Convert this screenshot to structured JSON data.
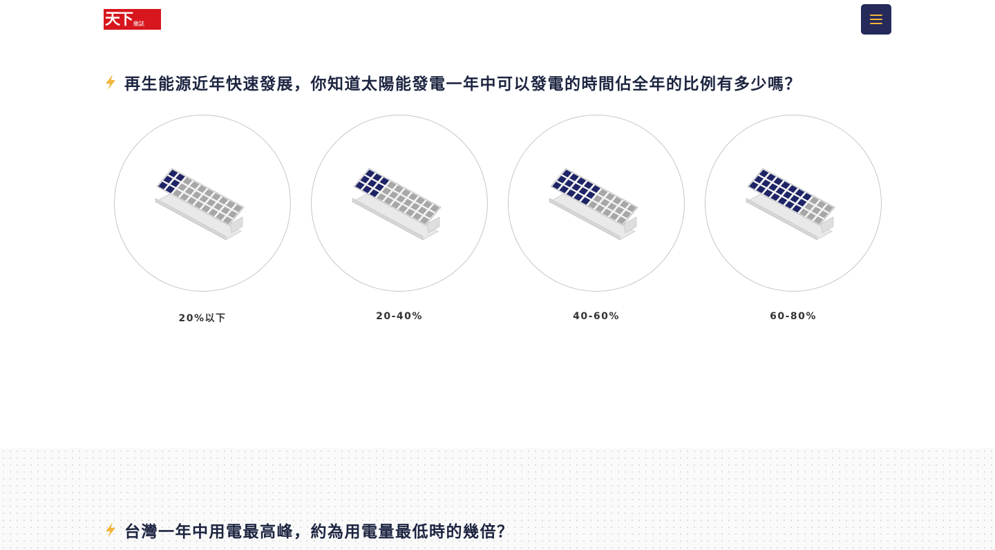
{
  "header": {
    "logo_text": "天下",
    "logo_subtext": "雜誌",
    "brand_color": "#d7161d",
    "menu_button_color": "#252a5a",
    "menu_icon_color": "#f3b53b",
    "menu_icon": "hamburger-menu-icon"
  },
  "question1": {
    "icon": "lightning-bolt-icon",
    "text": "再生能源近年快速發展，你知道太陽能發電一年中可以發電的時間佔全年的比例有多少嗎？",
    "options": [
      {
        "label": "20%以下",
        "dark_cells_fraction": 0.2
      },
      {
        "label": "20-40%",
        "dark_cells_fraction": 0.25
      },
      {
        "label": "40-60%",
        "dark_cells_fraction": 0.45
      },
      {
        "label": "60-80%",
        "dark_cells_fraction": 0.65
      }
    ]
  },
  "question2": {
    "icon": "lightning-bolt-icon",
    "text": "台灣一年中用電最高峰，約為用電量最低時的幾倍？"
  },
  "colors": {
    "text": "#1c2440",
    "bolt": "#f3b53b",
    "panel_dark": "#1f2466",
    "panel_light": "#a7a7a7"
  }
}
